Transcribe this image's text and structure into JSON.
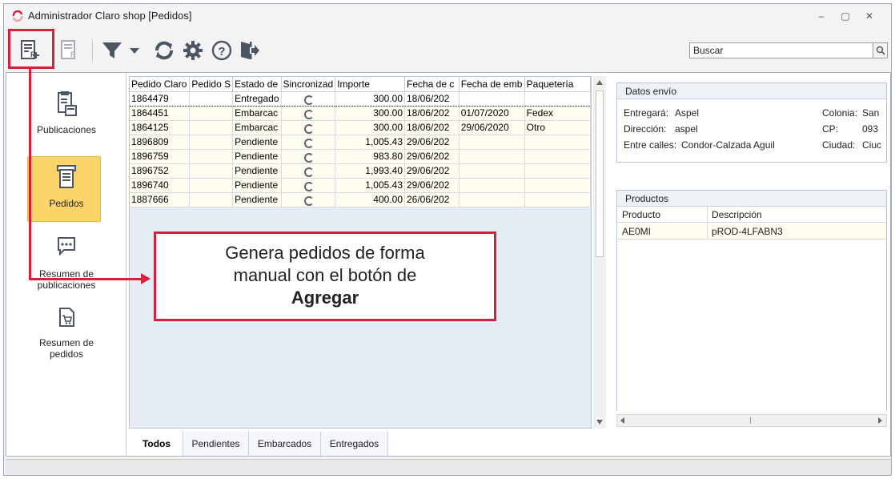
{
  "window": {
    "title": "Administrador Claro shop [Pedidos]"
  },
  "toolbar": {
    "search_placeholder": "Buscar",
    "buttons": [
      "agregar-icon",
      "editar-icon",
      "filter-icon",
      "refresh-icon",
      "settings-icon",
      "help-icon",
      "exit-icon"
    ]
  },
  "sidebar": {
    "items": [
      {
        "label": "Publicaciones"
      },
      {
        "label": "Pedidos"
      },
      {
        "label": "Resumen de publicaciones"
      },
      {
        "label": "Resumen de pedidos"
      }
    ]
  },
  "grid": {
    "columns": [
      "Pedido Claro",
      "Pedido S",
      "Estado de",
      "Sincronizad",
      "Importe",
      "Fecha de c",
      "Fecha de emb",
      "Paquetería"
    ],
    "rows": [
      [
        "1864479",
        "",
        "Entregado",
        "sync",
        "300.00",
        "18/06/202",
        "",
        ""
      ],
      [
        "1864451",
        "",
        "Embarcac",
        "sync",
        "300.00",
        "18/06/202",
        "01/07/2020",
        "Fedex"
      ],
      [
        "1864125",
        "",
        "Embarcac",
        "sync",
        "300.00",
        "18/06/202",
        "29/06/2020",
        "Otro"
      ],
      [
        "1896809",
        "",
        "Pendiente",
        "sync",
        "1,005.43",
        "29/06/202",
        "",
        ""
      ],
      [
        "1896759",
        "",
        "Pendiente",
        "sync",
        "983.80",
        "29/06/202",
        "",
        ""
      ],
      [
        "1896752",
        "",
        "Pendiente",
        "sync",
        "1,993.40",
        "29/06/202",
        "",
        ""
      ],
      [
        "1896740",
        "",
        "Pendiente",
        "sync",
        "1,005.43",
        "29/06/202",
        "",
        ""
      ],
      [
        "1887666",
        "",
        "Pendiente",
        "sync",
        "400.00",
        "26/06/202",
        "",
        ""
      ]
    ]
  },
  "tabs": [
    {
      "label": "Todos",
      "active": true
    },
    {
      "label": "Pendientes"
    },
    {
      "label": "Embarcados"
    },
    {
      "label": "Entregados"
    }
  ],
  "datos_envio": {
    "header": "Datos envío",
    "entregara_label": "Entregará:",
    "entregara": "Aspel",
    "direccion_label": "Dirección:",
    "direccion": "aspel",
    "entre_calles_label": "Entre calles:",
    "entre_calles": "Condor-Calzada Aguil",
    "colonia_label": "Colonia:",
    "colonia": "San",
    "cp_label": "CP:",
    "cp": "093",
    "ciudad_label": "Ciudad:",
    "ciudad": "Ciuc"
  },
  "productos": {
    "header": "Productos",
    "columns": [
      "Producto",
      "Descripción"
    ],
    "rows": [
      [
        "AE0MI",
        "pROD-4LFABN3"
      ]
    ]
  },
  "callout": {
    "line1": "Genera pedidos de forma",
    "line2": "manual con el botón de",
    "line3": "Agregar"
  },
  "colors": {
    "highlight": "#d6213d",
    "selected_nav": "#fbd56a",
    "grid_bg": "#e5ecf6"
  }
}
